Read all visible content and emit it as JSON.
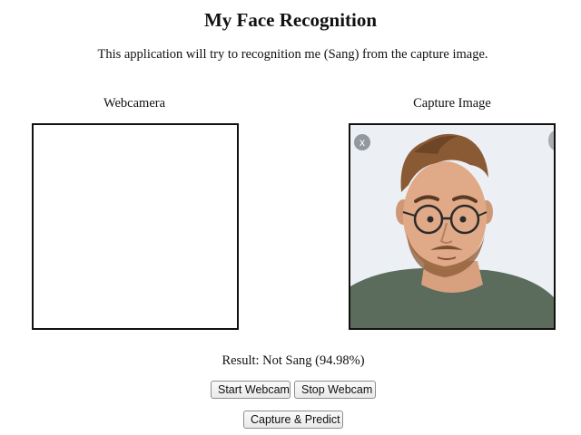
{
  "header": {
    "title": "My Face Recognition",
    "subtitle": "This application will try to recognition me (Sang) from the capture image."
  },
  "panels": {
    "webcam": {
      "label": "Webcamera"
    },
    "capture": {
      "label": "Capture Image",
      "close_glyph": "x"
    }
  },
  "result": {
    "text": "Result: Not Sang (94.98%)"
  },
  "buttons": {
    "start_webcam": "Start Webcam",
    "stop_webcam": "Stop Webcam",
    "capture_predict": "Capture & Predict"
  },
  "colors": {
    "frame_border": "#111111",
    "button_border": "#8e8e8e",
    "close_badge": "#8a8f95"
  }
}
